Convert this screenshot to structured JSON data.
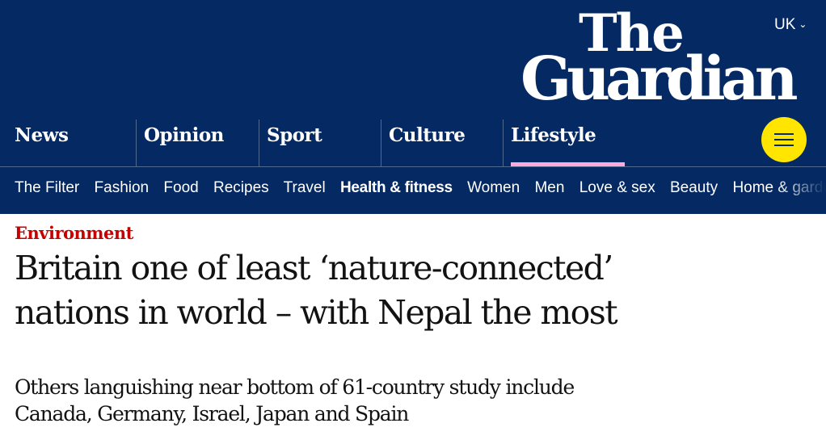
{
  "header": {
    "edition": "UK",
    "logo": {
      "line1": "The",
      "line2": "Guardian"
    },
    "pillars": [
      {
        "label": "News"
      },
      {
        "label": "Opinion"
      },
      {
        "label": "Sport"
      },
      {
        "label": "Culture"
      },
      {
        "label": "Lifestyle",
        "active": true
      }
    ],
    "subnav": [
      "The Filter",
      "Fashion",
      "Food",
      "Recipes",
      "Travel",
      "Health & fitness",
      "Women",
      "Men",
      "Love & sex",
      "Beauty",
      "Home & garden"
    ],
    "subnav_active": "Health & fitness",
    "colors": {
      "brand": "#052962",
      "accent": "#ffe500",
      "lifestyle": "#ffabdb",
      "section": "#c70000"
    }
  },
  "article": {
    "section": "Environment",
    "headline_line1": "Britain one of least ‘nature-connected’",
    "headline_line2": "nations in world – with Nepal the most",
    "standfirst_line1": "Others languishing near bottom of 61-country study include",
    "standfirst_line2": "Canada, Germany, Israel, Japan and Spain"
  },
  "icons": {
    "menu": "hamburger-menu-icon",
    "edition_toggle": "chevron-down-icon"
  }
}
